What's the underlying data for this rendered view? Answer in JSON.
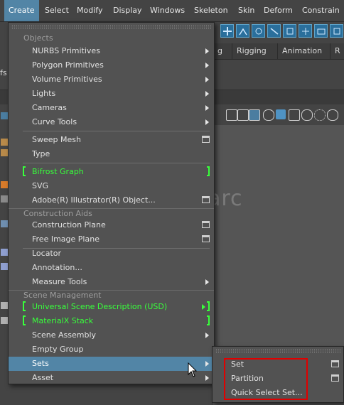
{
  "menubar": {
    "items": [
      "Create",
      "Select",
      "Modify",
      "Display",
      "Windows",
      "Skeleton",
      "Skin",
      "Deform",
      "Constrain"
    ]
  },
  "shelf_tabs": [
    "g",
    "Rigging",
    "Animation",
    "R"
  ],
  "ribbon_fragment": "fs",
  "watermark": "@dawn_arc",
  "create_menu": {
    "sections": {
      "objects": "Objects",
      "construction_aids": "Construction Aids",
      "scene_management": "Scene Management"
    },
    "items": {
      "nurbs_primitives": "NURBS Primitives",
      "polygon_primitives": "Polygon Primitives",
      "volume_primitives": "Volume Primitives",
      "lights": "Lights",
      "cameras": "Cameras",
      "curve_tools": "Curve Tools",
      "sweep_mesh": "Sweep Mesh",
      "type": "Type",
      "bifrost_graph": "Bifrost Graph",
      "svg": "SVG",
      "adobe_illustrator_object": "Adobe(R) Illustrator(R) Object...",
      "construction_plane": "Construction Plane",
      "free_image_plane": "Free Image Plane",
      "locator": "Locator",
      "annotation": "Annotation...",
      "measure_tools": "Measure Tools",
      "usd": "Universal Scene Description (USD)",
      "materialx_stack": "MaterialX Stack",
      "scene_assembly": "Scene Assembly",
      "empty_group": "Empty Group",
      "sets": "Sets",
      "asset": "Asset"
    }
  },
  "sets_submenu": {
    "items": {
      "set": "Set",
      "partition": "Partition",
      "quick_select_set": "Quick Select Set..."
    }
  },
  "colors": {
    "highlight": "#5285a6",
    "plugin_green": "#38ff3b",
    "callout_red": "#e00000"
  }
}
